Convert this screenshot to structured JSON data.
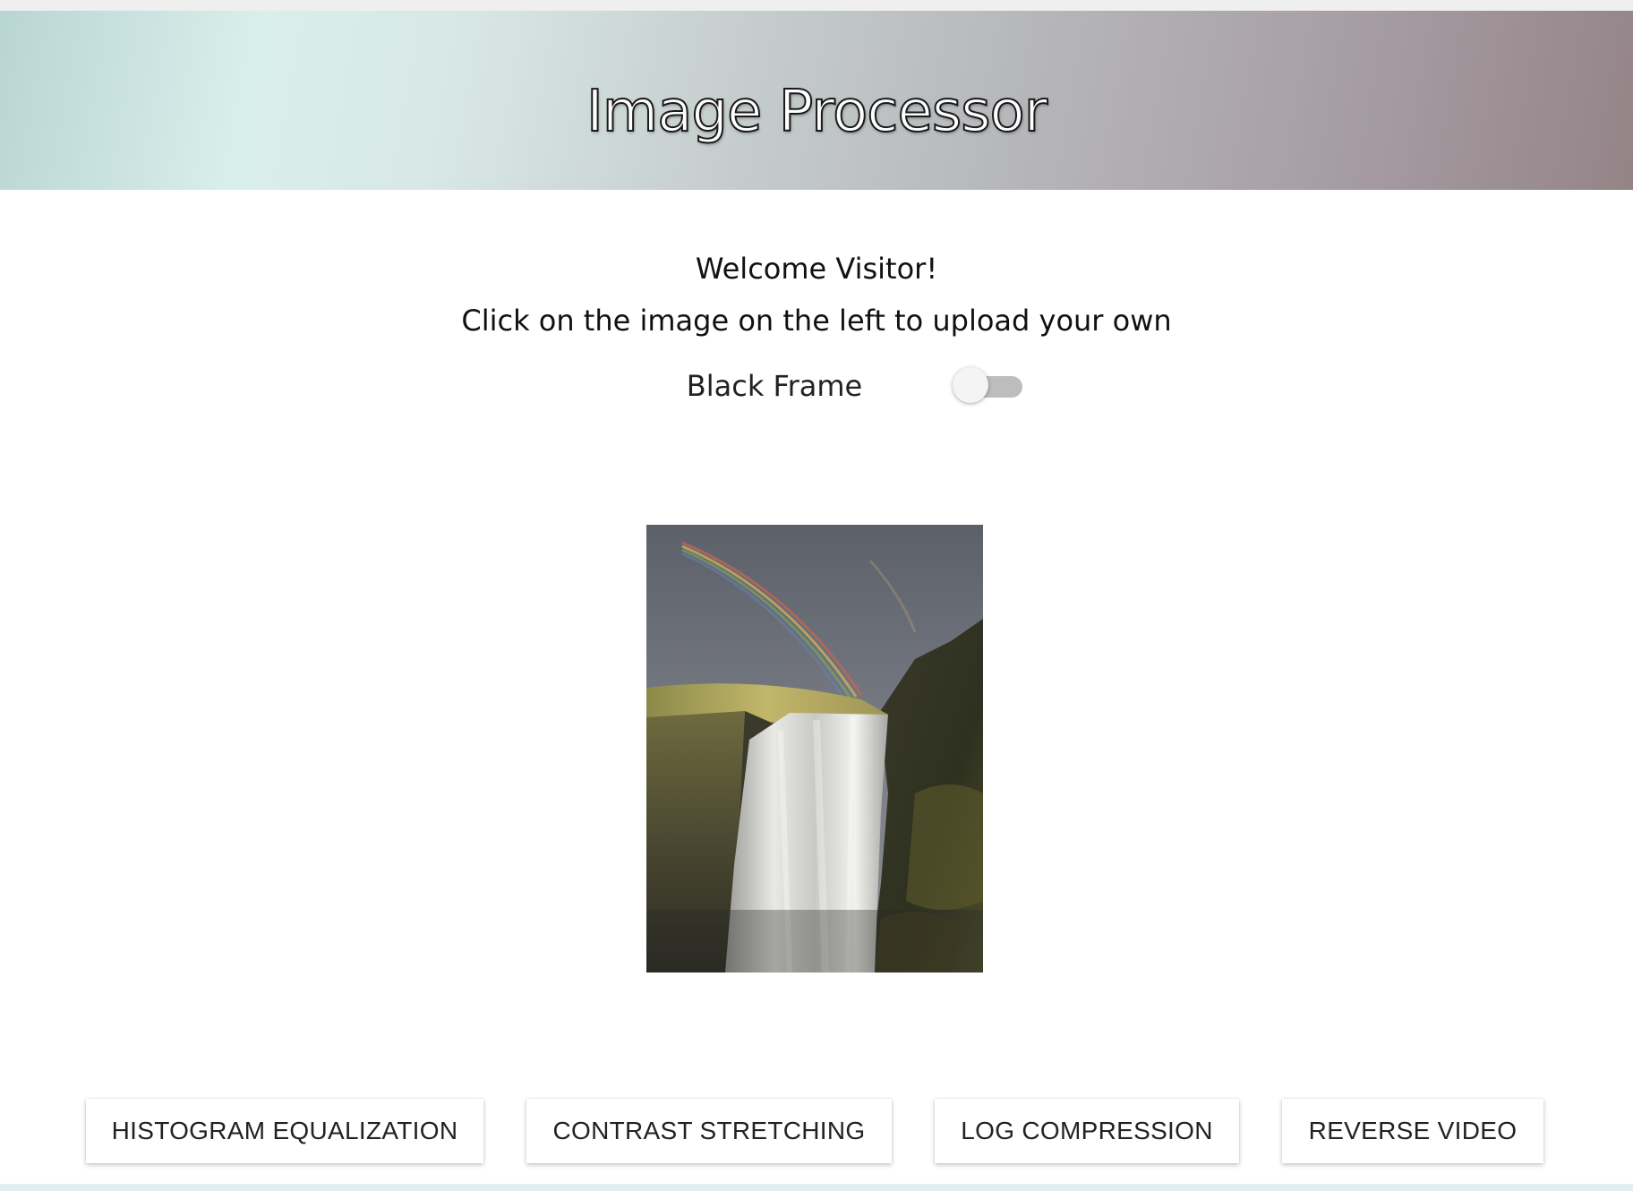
{
  "header": {
    "title": "Image Processor"
  },
  "intro": {
    "welcome": "Welcome Visitor!",
    "instruction": "Click on the image on the left to upload your own"
  },
  "toggle": {
    "label": "Black Frame",
    "state": "off"
  },
  "image": {
    "subject": "waterfall with rainbow",
    "alt": "waterfall"
  },
  "buttons": [
    {
      "label": "HISTOGRAM EQUALIZATION"
    },
    {
      "label": "CONTRAST STRETCHING"
    },
    {
      "label": "LOG COMPRESSION"
    },
    {
      "label": "REVERSE VIDEO"
    }
  ],
  "colors": {
    "header_gradient_start": "#b9d5d3",
    "header_gradient_end": "#948488",
    "toggle_track": "#bdbdbd",
    "toggle_knob": "#f4f4f4"
  }
}
